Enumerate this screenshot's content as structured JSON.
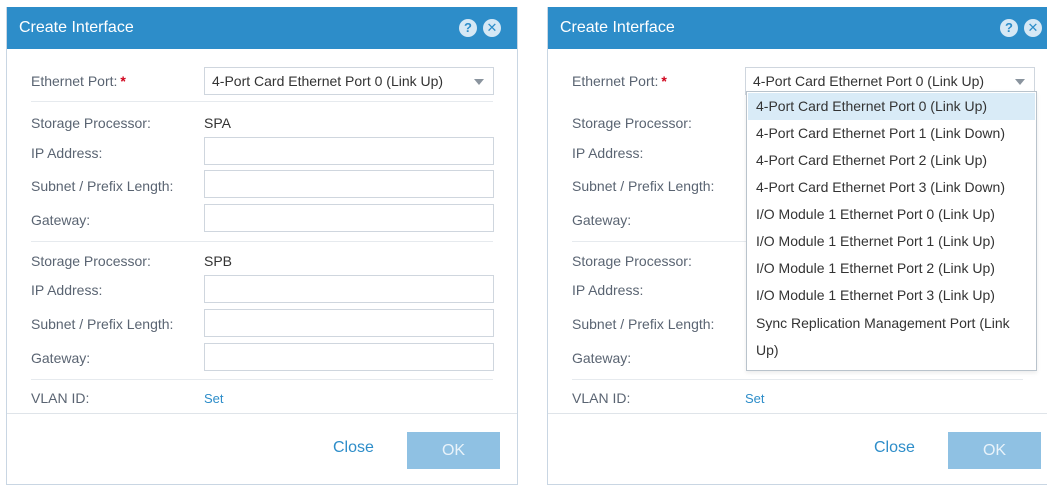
{
  "dialog_left": {
    "title": "Create Interface",
    "ethernet_port_label": "Ethernet Port:",
    "required_mark": "*",
    "ethernet_port_value": "4-Port Card Ethernet Port 0 (Link Up)",
    "spa_section": {
      "sp_label": "Storage Processor:",
      "sp_value": "SPA",
      "ip_label": "IP Address:",
      "ip_value": "",
      "subnet_label": "Subnet / Prefix Length:",
      "subnet_value": "",
      "gateway_label": "Gateway:",
      "gateway_value": ""
    },
    "spb_section": {
      "sp_label": "Storage Processor:",
      "sp_value": "SPB",
      "ip_label": "IP Address:",
      "ip_value": "",
      "subnet_label": "Subnet / Prefix Length:",
      "subnet_value": "",
      "gateway_label": "Gateway:",
      "gateway_value": ""
    },
    "vlan_label": "VLAN ID:",
    "vlan_link": "Set",
    "close_label": "Close",
    "ok_label": "OK"
  },
  "dialog_right": {
    "title": "Create Interface",
    "ethernet_port_label": "Ethernet Port:",
    "required_mark": "*",
    "ethernet_port_value": "4-Port Card Ethernet Port 0 (Link Up)",
    "labels": {
      "sp1": "Storage Processor:",
      "ip1": "IP Address:",
      "subnet1": "Subnet / Prefix Length:",
      "gateway1": "Gateway:",
      "sp2": "Storage Processor:",
      "ip2": "IP Address:",
      "subnet2": "Subnet / Prefix Length:",
      "gateway2": "Gateway:"
    },
    "dropdown_options": [
      "4-Port Card Ethernet Port 0 (Link Up)",
      "4-Port Card Ethernet Port 1 (Link Down)",
      "4-Port Card Ethernet Port 2 (Link Up)",
      "4-Port Card Ethernet Port 3 (Link Down)",
      "I/O Module 1 Ethernet Port 0 (Link Up)",
      "I/O Module 1 Ethernet Port 1 (Link Up)",
      "I/O Module 1 Ethernet Port 2 (Link Up)",
      "I/O Module 1 Ethernet Port 3 (Link Up)",
      "Sync Replication Management Port (Link Up)"
    ],
    "selected_option": "4-Port Card Ethernet Port 0 (Link Up)",
    "vlan_label": "VLAN ID:",
    "vlan_link": "Set",
    "close_label": "Close",
    "ok_label": "OK"
  },
  "icons": {
    "help": "help-icon",
    "close": "close-icon"
  },
  "colors": {
    "title_bar": "#2d8dc9",
    "required": "#d0021b",
    "link": "#2d8dc9",
    "ok_disabled": "#8fc1e3",
    "option_selected": "#d9ebf7"
  }
}
